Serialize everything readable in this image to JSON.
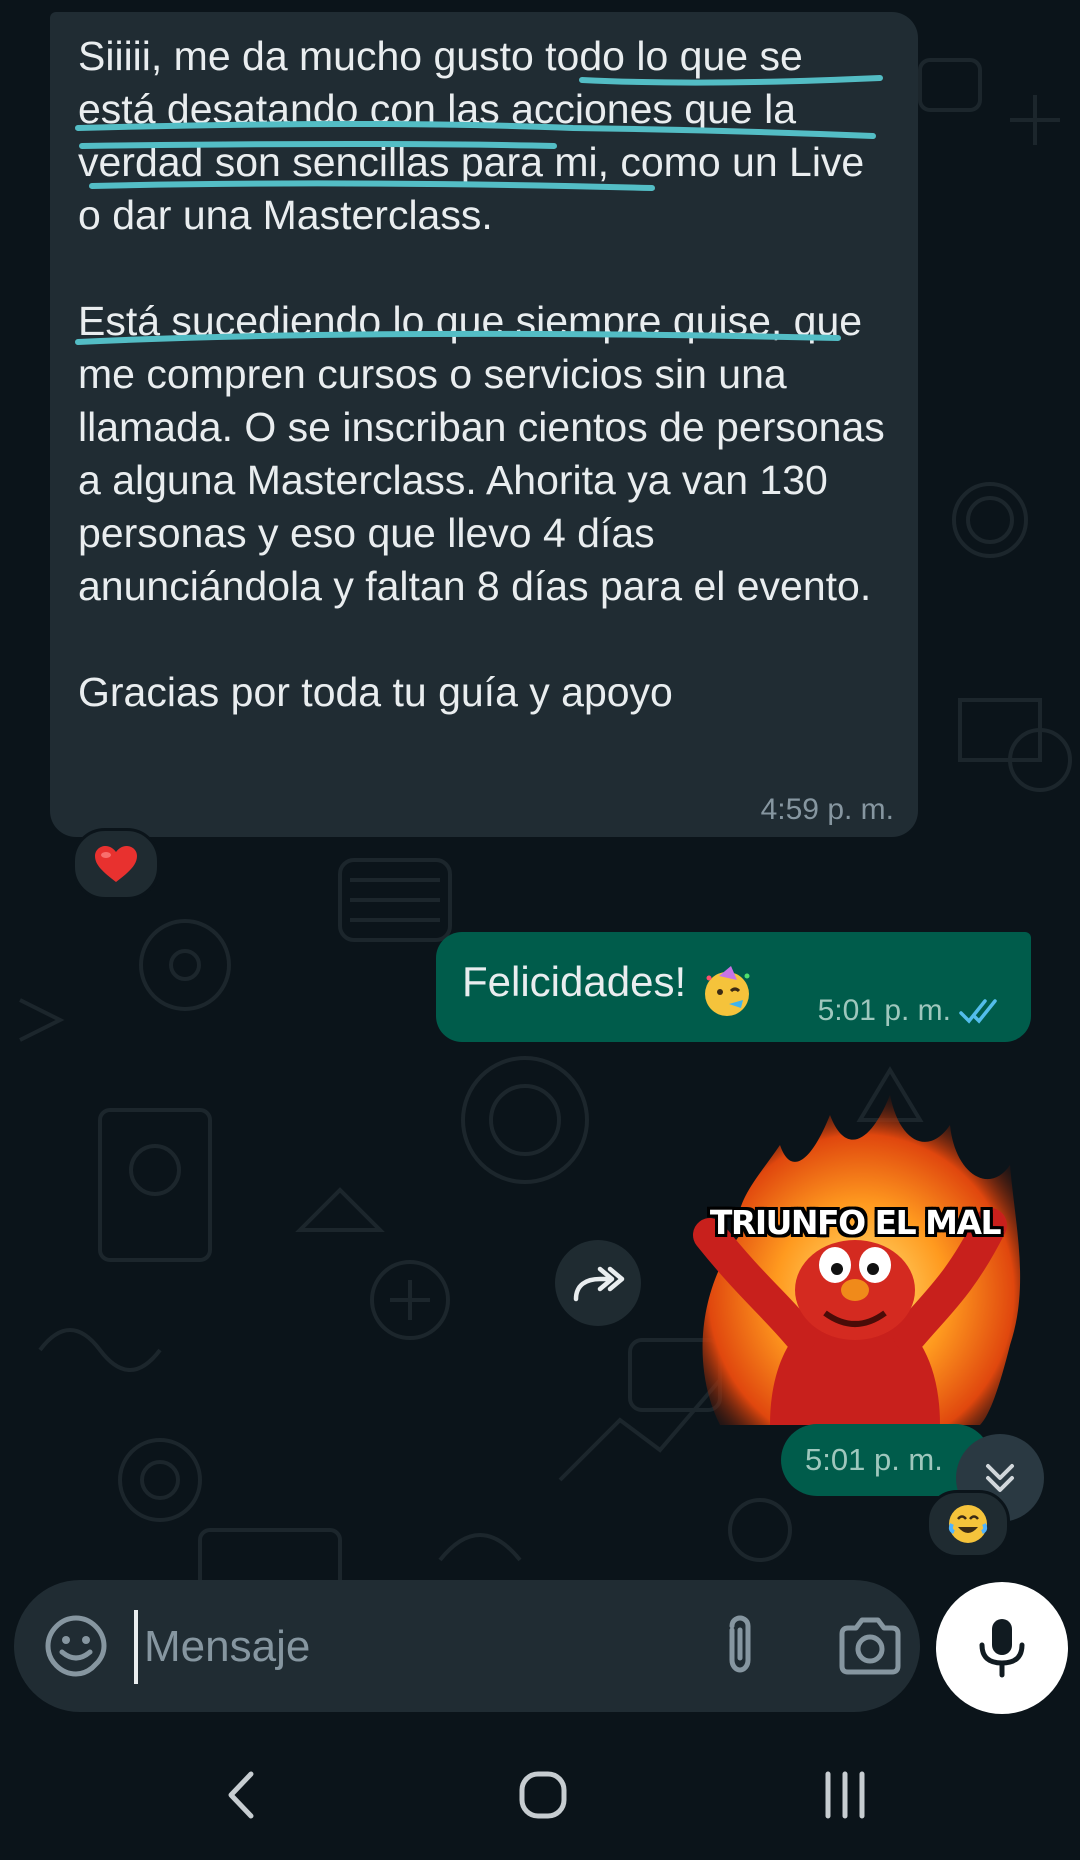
{
  "incoming_message": {
    "paragraphs": [
      "Siiiii, me da mucho gusto todo lo que se está desatando con las acciones que la verdad son sencillas para mi, como un Live o dar una Masterclass.",
      "Está sucediendo lo que siempre quise, que me compren cursos o servicios sin una llamada. O se inscriban cientos de personas a alguna Masterclass. Ahorita ya van 130 personas y eso que llevo 4 días anunciándola y faltan 8 días para el evento.",
      "Gracias por toda tu guía y apoyo"
    ],
    "time": "4:59 p. m.",
    "reaction": "heart"
  },
  "outgoing_message": {
    "text": "Felicidades!",
    "emoji": "partying-face",
    "time": "5:01 p. m.",
    "status": "read"
  },
  "sticker_message": {
    "caption": "TRIUNFO EL MAL",
    "time": "5:01 p. m.",
    "reaction": "face-with-tears-of-joy"
  },
  "composer": {
    "placeholder": "Mensaje"
  },
  "colors": {
    "background": "#0b141a",
    "incoming_bubble": "#202c33",
    "outgoing_bubble": "#005c4b",
    "highlight_underline": "#53bdc5",
    "read_ticks": "#53bdeb"
  },
  "icons": [
    "emoji-icon",
    "attach-icon",
    "camera-icon",
    "mic-icon",
    "forward-icon",
    "scroll-down-icon",
    "back-icon",
    "home-icon",
    "recents-icon"
  ]
}
